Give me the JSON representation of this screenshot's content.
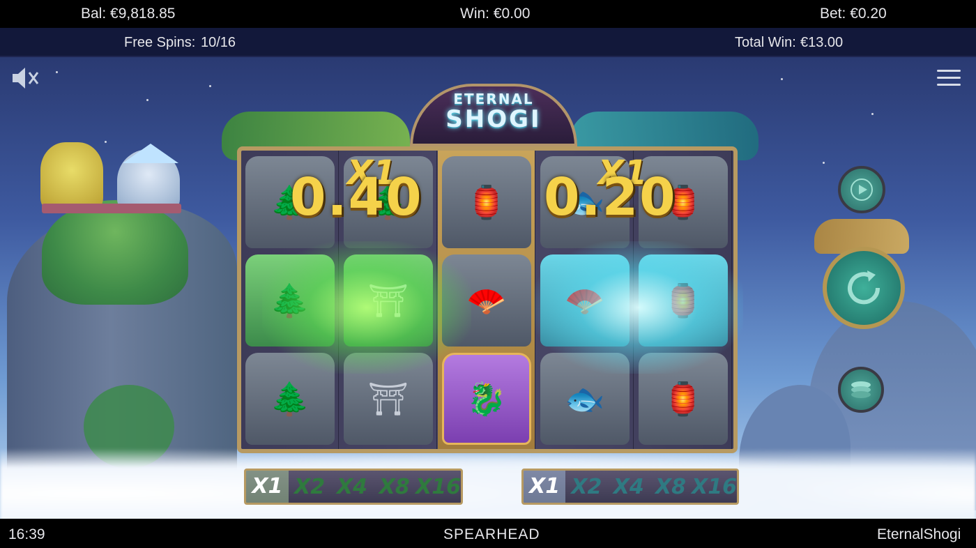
{
  "topbar": {
    "balance": "Bal: €9,818.85",
    "win": "Win: €0.00",
    "bet": "Bet: €0.20"
  },
  "freebar": {
    "free_spins_label": "Free Spins:",
    "free_spins_value": "10/16",
    "total_win_label": "Total Win:",
    "total_win_value": "€13.00"
  },
  "logo": {
    "line1": "ETERNAL",
    "line2": "SHOGI"
  },
  "reels": [
    [
      "bonsai",
      "bonsai",
      "bonsai"
    ],
    [
      "bonsai",
      "torii",
      "torii"
    ],
    [
      "lantern",
      "fan",
      "dragon"
    ],
    [
      "koi",
      "fan",
      "koi"
    ],
    [
      "lantern",
      "lantern",
      "lantern"
    ]
  ],
  "symbol_glyphs": {
    "bonsai": "🌲",
    "torii": "⛩",
    "lantern": "🏮",
    "fan": "🪭",
    "koi": "🐟",
    "dragon": "🐉"
  },
  "wins": {
    "left_amount": "0.40",
    "right_amount": "0.20",
    "left_multiplier": "X1",
    "right_multiplier": "X1"
  },
  "multiplier_trail_left": [
    "X1",
    "X2",
    "X4",
    "X8",
    "X16"
  ],
  "multiplier_trail_right": [
    "X1",
    "X2",
    "X4",
    "X8",
    "X16"
  ],
  "active_multiplier_index": 0,
  "bottombar": {
    "clock": "16:39",
    "brand": "SPEARHEAD",
    "game_name": "EternalShogi"
  },
  "colors": {
    "accent_gold": "#f5d24a",
    "green_glow": "#7be86a",
    "teal_glow": "#7ae4f0",
    "header_bar": "#12183a"
  },
  "icons": {
    "sound": "speaker-muted-icon",
    "menu": "hamburger-menu-icon",
    "autoplay": "play-icon",
    "spin": "spin-arrow-icon",
    "bet": "coin-stack-icon"
  }
}
